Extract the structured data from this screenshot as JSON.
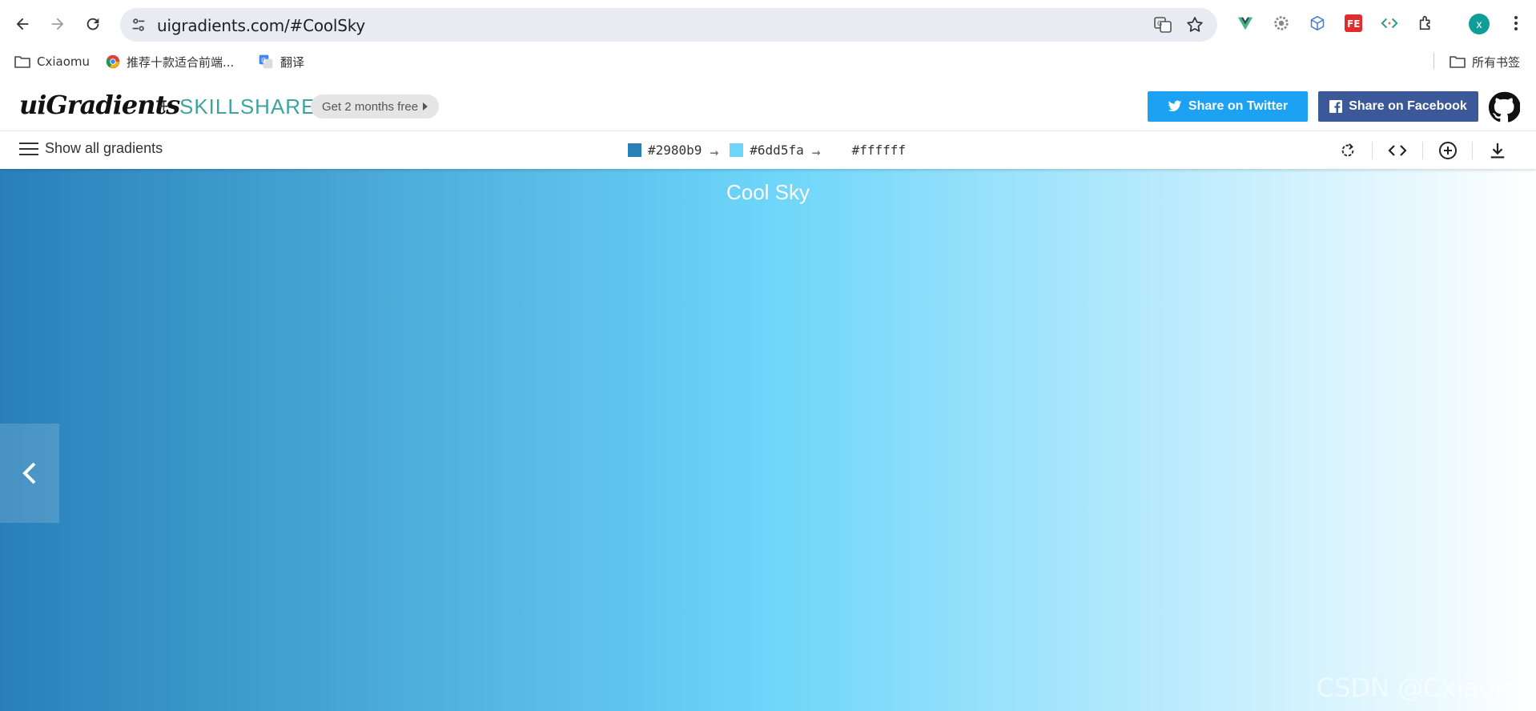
{
  "browser": {
    "url": "uigradients.com/#CoolSky",
    "profile_initial": "x"
  },
  "bookmarks": {
    "items": [
      {
        "label": "Cxiaomu",
        "icon": "folder-icon"
      },
      {
        "label": "推荐十款适合前端...",
        "icon": "chrome-icon"
      },
      {
        "label": "翻译",
        "icon": "translate-icon"
      }
    ],
    "all_bookmarks": "所有书签"
  },
  "header": {
    "logo": "uiGradients",
    "plus": "+",
    "partner": "SKILLSHARE",
    "promo": "Get 2 months free",
    "share_twitter": "Share on Twitter",
    "share_facebook": "Share on Facebook"
  },
  "toolbar": {
    "menu_label": "Show all gradients",
    "colors": [
      {
        "hex": "#2980b9",
        "color": "#2980b9"
      },
      {
        "hex": "#6dd5fa",
        "color": "#6dd5fa"
      },
      {
        "hex": "#ffffff",
        "color": "#ffffff"
      }
    ],
    "arrow": "→"
  },
  "gradient": {
    "name": "Cool Sky",
    "stops": [
      "#2980b9",
      "#6dd5fa",
      "#ffffff"
    ]
  },
  "watermark": "CSDN @Cxiaomu"
}
